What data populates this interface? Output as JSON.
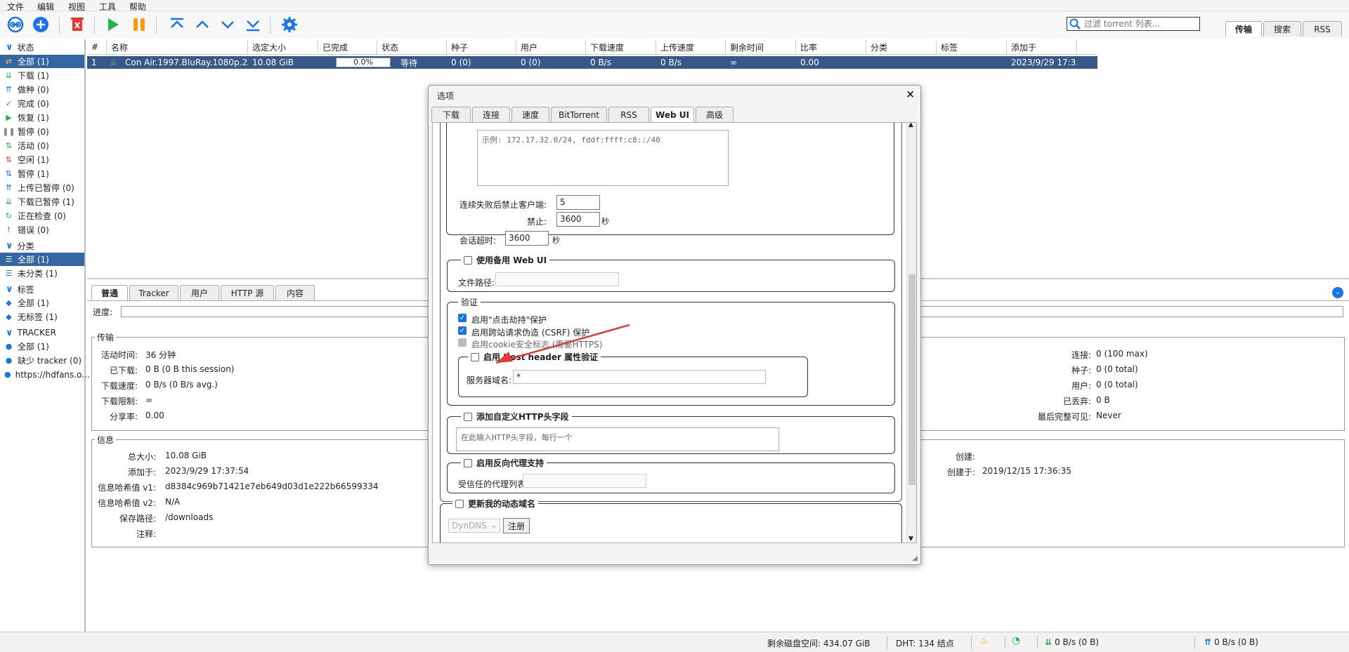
{
  "menu": [
    "文件",
    "编辑",
    "视图",
    "工具",
    "帮助"
  ],
  "search": {
    "placeholder": "过滤 torrent 列表..."
  },
  "top_tabs": [
    "传输",
    "搜索",
    "RSS"
  ],
  "sidebar": {
    "status_header": "状态",
    "status_items": [
      {
        "label": "全部 (1)",
        "icon": "shuffle-icon"
      },
      {
        "label": "下载 (1)",
        "icon": "download-icon"
      },
      {
        "label": "做种 (0)",
        "icon": "upload-icon"
      },
      {
        "label": "完成 (0)",
        "icon": "check-icon"
      },
      {
        "label": "恢复 (1)",
        "icon": "play-icon"
      },
      {
        "label": "暂停 (0)",
        "icon": "pause-icon"
      },
      {
        "label": "活动 (0)",
        "icon": "active-icon"
      },
      {
        "label": "空闲 (1)",
        "icon": "inactive-icon"
      },
      {
        "label": "暂停 (1)",
        "icon": "stalled-icon"
      },
      {
        "label": "上传已暂停 (0)",
        "icon": "stalled-up-icon"
      },
      {
        "label": "下载已暂停 (1)",
        "icon": "stalled-down-icon"
      },
      {
        "label": "正在检查 (0)",
        "icon": "checking-icon"
      },
      {
        "label": "错误 (0)",
        "icon": "error-icon"
      }
    ],
    "category_header": "分类",
    "category_items": [
      {
        "label": "全部 (1)",
        "icon": "list-icon"
      },
      {
        "label": "未分类 (1)",
        "icon": "list-icon"
      }
    ],
    "tag_header": "标签",
    "tag_items": [
      {
        "label": "全部 (1)",
        "icon": "tag-icon"
      },
      {
        "label": "无标签 (1)",
        "icon": "tag-icon"
      }
    ],
    "tracker_header": "TRACKER",
    "tracker_items": [
      {
        "label": "全部 (1)",
        "icon": "pin-icon"
      },
      {
        "label": "缺少 tracker (0)",
        "icon": "pin-icon"
      },
      {
        "label": "https://hdfans.o...",
        "icon": "pin-icon"
      }
    ]
  },
  "table": {
    "columns": [
      "#",
      "名称",
      "选定大小",
      "已完成",
      "状态",
      "种子",
      "用户",
      "下载速度",
      "上传速度",
      "剩余时间",
      "比率",
      "分类",
      "标签",
      "添加于"
    ],
    "row": {
      "num": "1",
      "name": "Con Air.1997.BluRay.1080p.2Audi...",
      "size": "10.08 GiB",
      "done": "0.0%",
      "progress_value": 0,
      "status": "等待",
      "seeds": "0 (0)",
      "peers": "0 (0)",
      "dl": "0 B/s",
      "ul": "0 B/s",
      "eta": "∞",
      "ratio": "0.00",
      "category": "",
      "tags": "",
      "added": "2023/9/29 17:3..."
    }
  },
  "bottom_tabs": [
    "普通",
    "Tracker",
    "用户",
    "HTTP 源",
    "内容"
  ],
  "progress_label": "进度:",
  "transfer": {
    "legend": "传输",
    "left": [
      {
        "k": "活动时间:",
        "v": "36 分钟"
      },
      {
        "k": "已下载:",
        "v": "0 B (0 B this session)"
      },
      {
        "k": "下载速度:",
        "v": "0 B/s (0 B/s avg.)"
      },
      {
        "k": "下载限制:",
        "v": "∞"
      },
      {
        "k": "分享率:",
        "v": "0.00"
      }
    ],
    "right": [
      {
        "k": "连接:",
        "v": "0 (100 max)"
      },
      {
        "k": "种子:",
        "v": "0 (0 total)"
      },
      {
        "k": "用户:",
        "v": "0 (0 total)"
      },
      {
        "k": "已丢弃:",
        "v": "0 B"
      },
      {
        "k": "最后完整可见:",
        "v": "Never"
      }
    ]
  },
  "info": {
    "legend": "信息",
    "left": [
      {
        "k": "总大小:",
        "v": "10.08 GiB"
      },
      {
        "k": "添加于:",
        "v": "2023/9/29 17:37:54"
      },
      {
        "k": "信息哈希值 v1:",
        "v": "d8384c969b71421e7eb649d03d1e222b66599334"
      },
      {
        "k": "信息哈希值 v2:",
        "v": "N/A"
      },
      {
        "k": "保存路径:",
        "v": "/downloads"
      },
      {
        "k": "注释:",
        "v": ""
      }
    ],
    "right": [
      {
        "k": "创建:",
        "v": ""
      },
      {
        "k": "创建于:",
        "v": "2019/12/15 17:36:35"
      }
    ]
  },
  "status_bar": {
    "disk": "剩余磁盘空间: 434.07 GiB",
    "dht": "DHT: 134 结点",
    "dl": "0 B/s (0 B)",
    "ul": "0 B/s (0 B)"
  },
  "dialog": {
    "title": "选项",
    "close": "×",
    "tabs": [
      "下载",
      "连接",
      "速度",
      "BitTorrent",
      "RSS",
      "Web UI",
      "高级"
    ],
    "whitelist_placeholder": "示例: 172.17.32.0/24, fddf:ffff:c8::/40",
    "ban_after_label": "连续失败后禁止客户端:",
    "ban_after_value": "5",
    "ban_for_label": "禁止:",
    "ban_for_value": "3600",
    "ban_for_unit": "秒",
    "session_timeout_label": "会话超时:",
    "session_timeout_value": "3600",
    "session_timeout_unit": "秒",
    "alt_webui_title": "使用备用 Web UI",
    "alt_webui_path_label": "文件路径:",
    "auth_title": "验证",
    "clickjacking_label": "启用\"点击劫持\"保护",
    "csrf_label": "启用跨站请求伪造 (CSRF) 保护",
    "cookie_label": "启用cookie安全标志 (需要HTTPS)",
    "host_header_title": "启用 Host header 属性验证",
    "server_domains_label": "服务器域名:",
    "server_domains_value": "*",
    "custom_http_title": "添加自定义HTTP头字段",
    "custom_http_placeholder": "在此输入HTTP头字段，每行一个",
    "reverse_proxy_title": "启用反向代理支持",
    "trusted_proxies_label": "受信任的代理列表:",
    "dyndns_title": "更新我的动态域名",
    "dyndns_service": "DynDNS",
    "register_label": "注册"
  }
}
